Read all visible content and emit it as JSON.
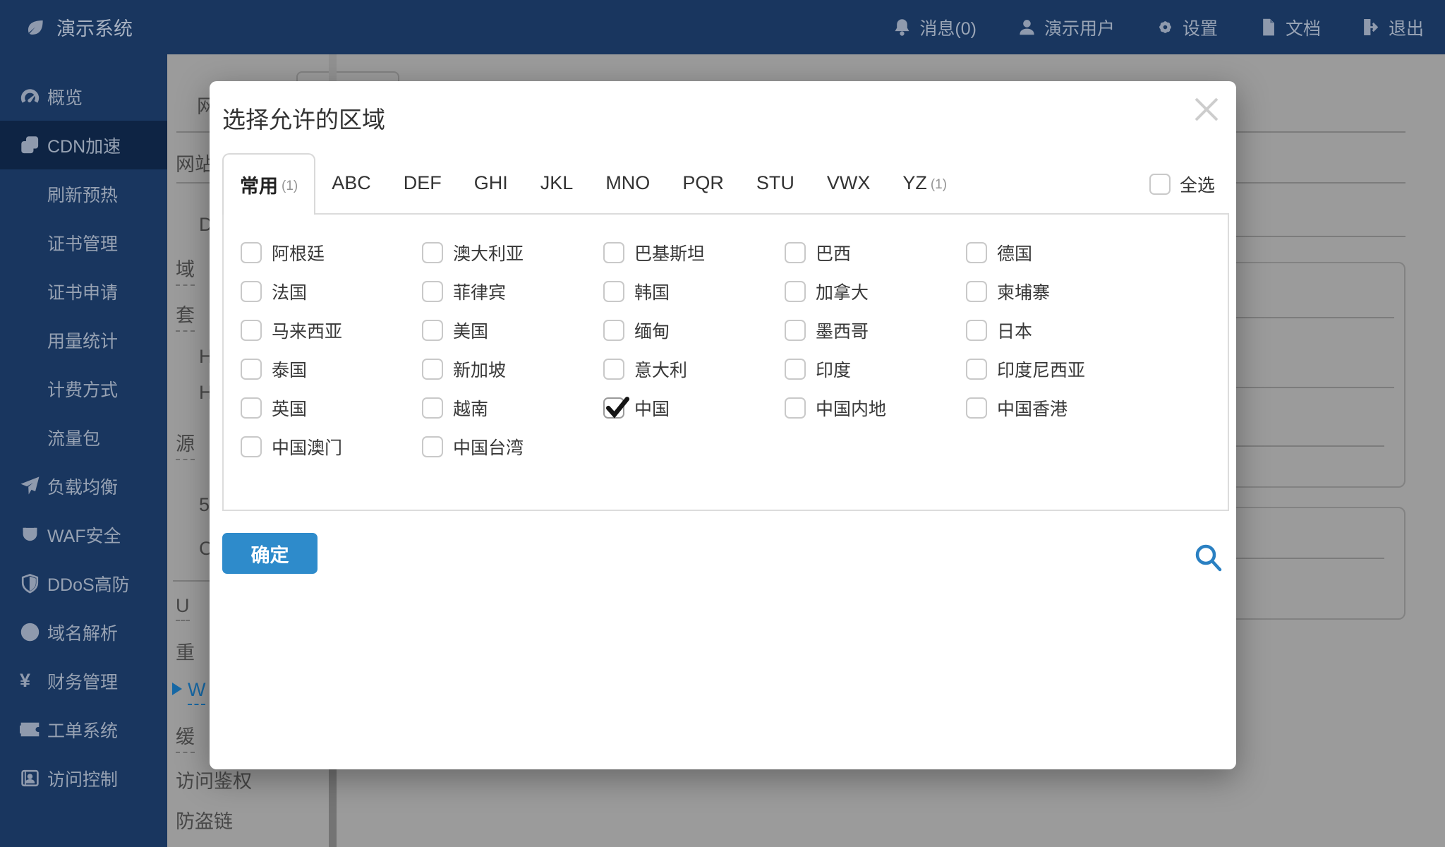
{
  "colors": {
    "navy": "#19365f",
    "navy_active": "#0e2444",
    "backdrop_gray": "#9b9b9b",
    "accent_blue": "#2e8bcb",
    "link_blue": "#1668a5"
  },
  "topbar": {
    "brand": "演示系统",
    "brand_icon": "leaf-icon",
    "items": [
      {
        "icon": "bell-icon",
        "label": "消息(0)"
      },
      {
        "icon": "user-icon",
        "label": "演示用户"
      },
      {
        "icon": "gear-icon",
        "label": "设置"
      },
      {
        "icon": "document-icon",
        "label": "文档"
      },
      {
        "icon": "logout-icon",
        "label": "退出"
      }
    ]
  },
  "sidebar": {
    "items": [
      {
        "icon": "dashboard-icon",
        "label": "概览"
      },
      {
        "icon": "cdn-icon",
        "label": "CDN加速",
        "active": true
      },
      {
        "label": "刷新预热",
        "sub": true
      },
      {
        "label": "证书管理",
        "sub": true
      },
      {
        "label": "证书申请",
        "sub": true
      },
      {
        "label": "用量统计",
        "sub": true
      },
      {
        "label": "计费方式",
        "sub": true
      },
      {
        "label": "流量包",
        "sub": true
      },
      {
        "icon": "paper-plane-icon",
        "label": "负载均衡"
      },
      {
        "icon": "magnet-icon",
        "label": "WAF安全"
      },
      {
        "icon": "shield-icon",
        "label": "DDoS高防"
      },
      {
        "icon": "globe-icon",
        "label": "域名解析"
      },
      {
        "icon": "yen-icon",
        "label": "财务管理"
      },
      {
        "icon": "ticket-icon",
        "label": "工单系统"
      },
      {
        "icon": "idcard-icon",
        "label": "访问控制"
      }
    ]
  },
  "modal": {
    "title": "选择允许的区域",
    "close_icon": "close-icon",
    "tabs": [
      {
        "label": "常用",
        "count": "(1)",
        "active": true
      },
      {
        "label": "ABC"
      },
      {
        "label": "DEF"
      },
      {
        "label": "GHI"
      },
      {
        "label": "JKL"
      },
      {
        "label": "MNO"
      },
      {
        "label": "PQR"
      },
      {
        "label": "STU"
      },
      {
        "label": "VWX"
      },
      {
        "label": "YZ",
        "count": "(1)"
      }
    ],
    "select_all_label": "全选",
    "regions": [
      {
        "label": "阿根廷"
      },
      {
        "label": "澳大利亚"
      },
      {
        "label": "巴基斯坦"
      },
      {
        "label": "巴西"
      },
      {
        "label": "德国"
      },
      {
        "label": "法国"
      },
      {
        "label": "菲律宾"
      },
      {
        "label": "韩国"
      },
      {
        "label": "加拿大"
      },
      {
        "label": "柬埔寨"
      },
      {
        "label": "马来西亚"
      },
      {
        "label": "美国"
      },
      {
        "label": "缅甸"
      },
      {
        "label": "墨西哥"
      },
      {
        "label": "日本"
      },
      {
        "label": "泰国"
      },
      {
        "label": "新加坡"
      },
      {
        "label": "意大利"
      },
      {
        "label": "印度"
      },
      {
        "label": "印度尼西亚"
      },
      {
        "label": "英国"
      },
      {
        "label": "越南"
      },
      {
        "label": "中国",
        "checked": true
      },
      {
        "label": "中国内地"
      },
      {
        "label": "中国香港"
      },
      {
        "label": "中国澳门"
      },
      {
        "label": "中国台湾"
      }
    ],
    "confirm_label": "确定",
    "search_icon": "search-icon"
  },
  "background": {
    "fragments": {
      "wang": "网",
      "wangzhan": "网站",
      "d": "D",
      "yu": "域",
      "tao": "套",
      "h1": "H",
      "h2": "H",
      "yuan": "源",
      "five": "5",
      "c": "C",
      "u": "U",
      "zhong": "重",
      "w": "W",
      "huan": "缓",
      "auth": "访问鉴权",
      "fangdao": "防盗链"
    }
  }
}
